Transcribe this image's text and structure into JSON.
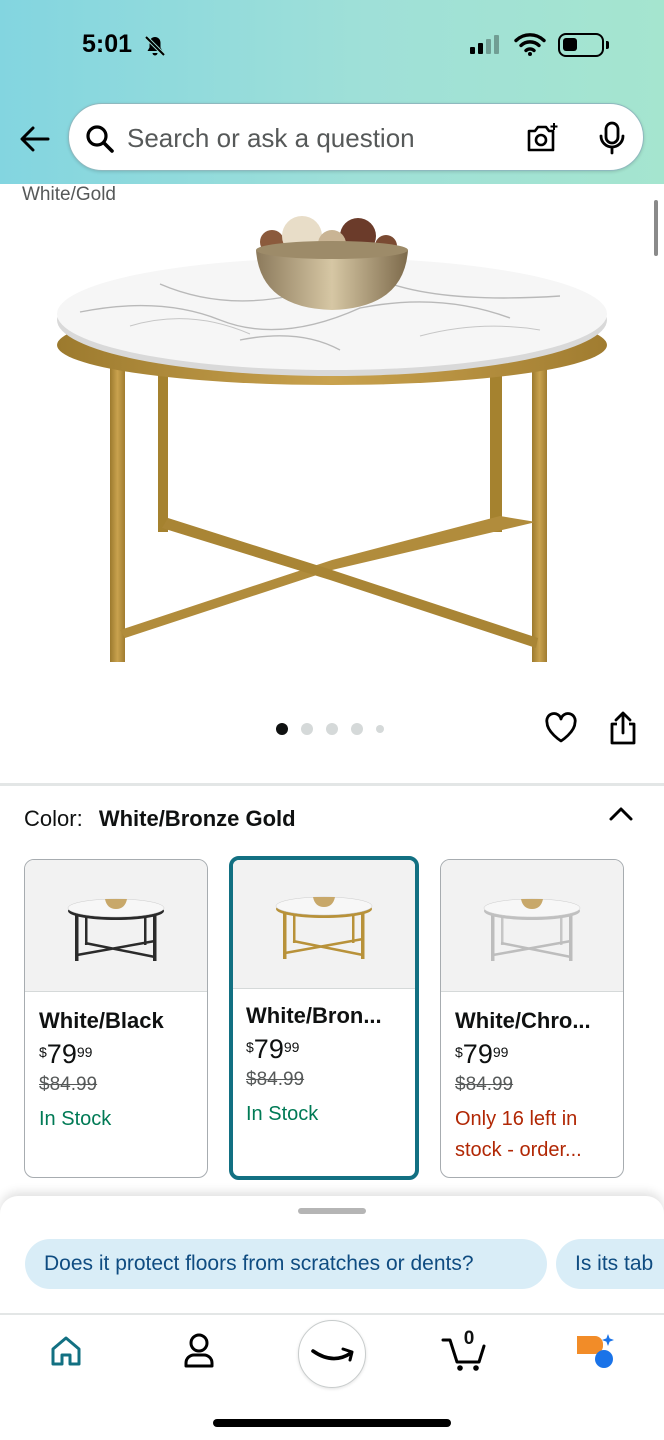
{
  "status_bar": {
    "time": "5:01"
  },
  "search": {
    "placeholder": "Search or ask a question"
  },
  "product": {
    "variant_caption": "White/Gold",
    "image_count": 5,
    "active_image": 1
  },
  "color_selector": {
    "label": "Color:",
    "selected": "White/Bronze Gold",
    "options": [
      {
        "name": "White/Black",
        "price_symbol": "$",
        "price_whole": "79",
        "price_fraction": "99",
        "list_price": "$84.99",
        "stock": "In Stock",
        "stock_status": "in",
        "frame_color": "#2b2b2b"
      },
      {
        "name": "White/Bron...",
        "price_symbol": "$",
        "price_whole": "79",
        "price_fraction": "99",
        "list_price": "$84.99",
        "stock": "In Stock",
        "stock_status": "in",
        "frame_color": "#b8923a"
      },
      {
        "name": "White/Chro...",
        "price_symbol": "$",
        "price_whole": "79",
        "price_fraction": "99",
        "list_price": "$84.99",
        "stock_line1": "Only 16 left in",
        "stock_line2": "stock - order...",
        "stock_status": "low",
        "frame_color": "#c0c0c0"
      }
    ]
  },
  "questions": {
    "chips": [
      "Does it protect floors from scratches or dents?",
      "Is its tab"
    ]
  },
  "bottom_nav": {
    "items": [
      "home-icon",
      "profile-icon",
      "amazon-icon",
      "cart-icon",
      "rufus-icon"
    ],
    "cart_count": "0"
  },
  "colors": {
    "header_gradient_start": "#83d5e0",
    "header_gradient_end": "#a5e5cf",
    "selected_border": "#127082",
    "in_stock": "#007a55",
    "low_stock": "#b12704",
    "chip_background": "#d9edf7"
  }
}
